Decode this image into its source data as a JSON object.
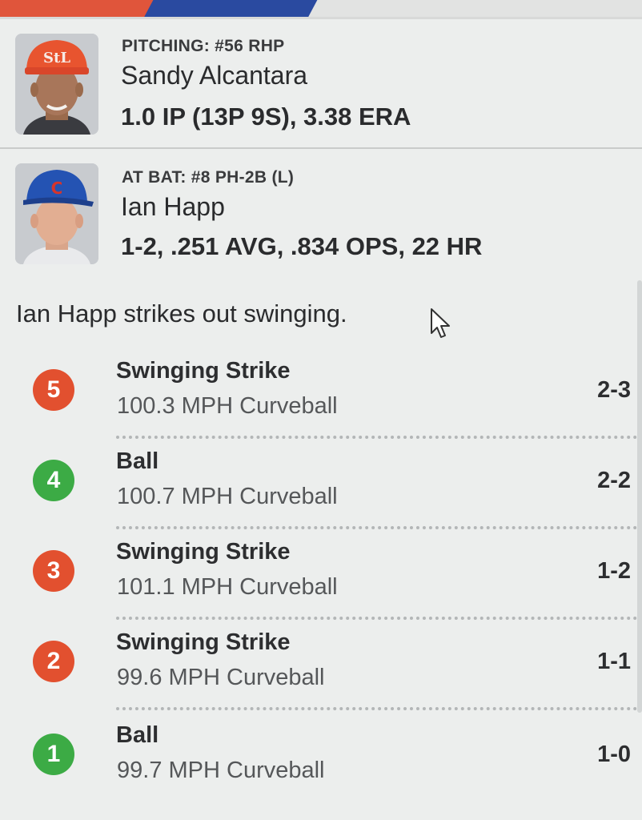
{
  "pitcher": {
    "label": "PITCHING: #56 RHP",
    "name": "Sandy Alcantara",
    "stats": "1.0 IP (13P 9S), 3.38 ERA"
  },
  "batter": {
    "label": "AT BAT: #8 PH-2B (L)",
    "name": "Ian Happ",
    "stats": "1-2, .251 AVG, .834 OPS, 22 HR"
  },
  "play_result": "Ian Happ strikes out swinging.",
  "pitches": [
    {
      "number": "5",
      "result": "Swinging Strike",
      "detail": "100.3 MPH Curveball",
      "count": "2-3",
      "type": "strike"
    },
    {
      "number": "4",
      "result": "Ball",
      "detail": "100.7 MPH Curveball",
      "count": "2-2",
      "type": "ball"
    },
    {
      "number": "3",
      "result": "Swinging Strike",
      "detail": "101.1 MPH Curveball",
      "count": "1-2",
      "type": "strike"
    },
    {
      "number": "2",
      "result": "Swinging Strike",
      "detail": "99.6 MPH Curveball",
      "count": "1-1",
      "type": "strike"
    },
    {
      "number": "1",
      "result": "Ball",
      "detail": "99.7 MPH Curveball",
      "count": "1-0",
      "type": "ball"
    }
  ],
  "colors": {
    "strike": "#e2502f",
    "ball": "#3cab45",
    "header_red": "#e0553b",
    "header_blue": "#2a4aa0",
    "pitcher_cap": "#e8542f",
    "batter_cap": "#2453b3"
  },
  "icons": {
    "pitcher_photo": "player-headshot-red-cap",
    "batter_photo": "player-headshot-blue-cap",
    "cursor": "mouse-pointer-icon"
  }
}
